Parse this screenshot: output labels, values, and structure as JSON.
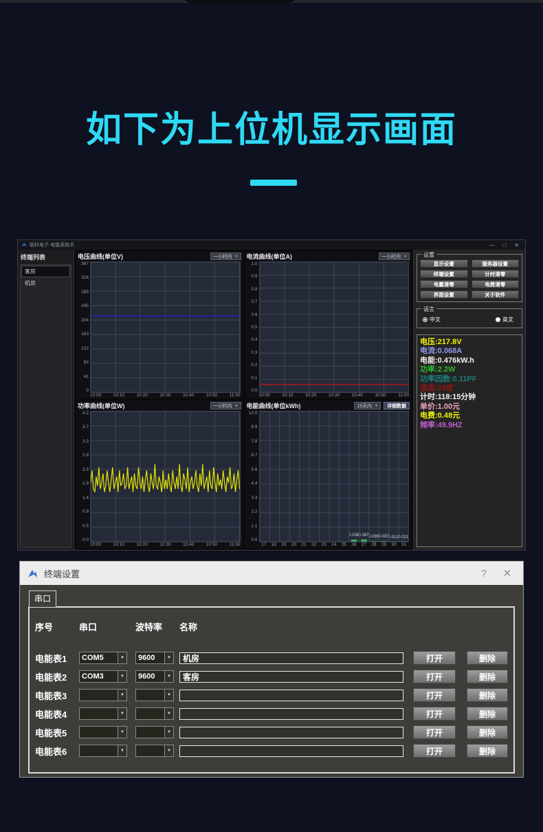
{
  "glyphs": {
    "dropdown_arrow": "▼",
    "minimize": "—",
    "maximize": "□",
    "close": "✕",
    "help": "?"
  },
  "page": {
    "heading": "如下为上位机显示画面",
    "accent_color": "#2fd9f4"
  },
  "app_window": {
    "title": "联科电子-电能表助手",
    "sidebar": {
      "title": "终端列表",
      "items": [
        {
          "label": "客房",
          "selected": true
        },
        {
          "label": "机房",
          "selected": false
        }
      ]
    },
    "right_panel": {
      "settings_group": {
        "title": "设置",
        "buttons": [
          "显示设置",
          "服务器设置",
          "终端设置",
          "计时清零",
          "电量清零",
          "电费清零",
          "界面设置",
          "关于软件"
        ]
      },
      "language_group": {
        "title": "语言",
        "options": [
          {
            "label": "中文",
            "selected": true
          },
          {
            "label": "英文",
            "selected": false
          }
        ]
      },
      "readings": [
        {
          "text": "电压:217.8V",
          "color": "#f2f20a"
        },
        {
          "text": "电流:0.068A",
          "color": "#8f9bf0"
        },
        {
          "text": "电能:0.476kW.h",
          "color": "#f2f2f2"
        },
        {
          "text": "功率:2.2W",
          "color": "#2db82d"
        },
        {
          "text": "功率因数:0.11PF",
          "color": "#1f7d7a"
        },
        {
          "text": "温度:26度",
          "color": "#8a1717"
        },
        {
          "text": "计时:118:15分钟",
          "color": "#f2f2f2"
        },
        {
          "text": "单价:1.00元",
          "color": "#eda4be"
        },
        {
          "text": "电费:0.48元",
          "color": "#f2f20a"
        },
        {
          "text": "频率:49.9HZ",
          "color": "#bb5fd0"
        }
      ]
    }
  },
  "chart_data": [
    {
      "type": "line",
      "title": "电压曲线(单位V)",
      "range_label": "一小时内",
      "color": "#1b1be0",
      "ylim": [
        0,
        367
      ],
      "y_ticks": [
        "367",
        "326",
        "285",
        "245",
        "204",
        "163",
        "122",
        "82",
        "41",
        "0"
      ],
      "x_ticks": [
        "10:00",
        "10:10",
        "10:20",
        "10:30",
        "10:40",
        "10:50",
        "11:00"
      ],
      "grid": true,
      "values": [
        215,
        216,
        215,
        214,
        215,
        216,
        215,
        214,
        213,
        214,
        215,
        216,
        215,
        215,
        214,
        215,
        216,
        215,
        214,
        215,
        216,
        217,
        215,
        214,
        215,
        214,
        213,
        214,
        215,
        216,
        215,
        214,
        215,
        216,
        215,
        214,
        215,
        216,
        215,
        215,
        214,
        213,
        214,
        215,
        216,
        215,
        214,
        215,
        216,
        215,
        214,
        215,
        216,
        215,
        216,
        215,
        214,
        215,
        216,
        217
      ]
    },
    {
      "type": "line",
      "title": "电流曲线(单位A)",
      "range_label": "一小时内",
      "color": "#c81616",
      "ylim": [
        0,
        1.0
      ],
      "y_ticks": [
        "1.0",
        "0.9",
        "0.8",
        "0.7",
        "0.6",
        "0.5",
        "0.4",
        "0.3",
        "0.2",
        "0.1",
        "0.0"
      ],
      "x_ticks": [
        "10:00",
        "10:10",
        "10:20",
        "10:30",
        "10:40",
        "10:50",
        "11:00"
      ],
      "grid": true,
      "values": [
        0.06,
        0.062,
        0.059,
        0.06,
        0.061,
        0.06,
        0.058,
        0.06,
        0.062,
        0.06,
        0.059,
        0.06,
        0.061,
        0.06,
        0.059,
        0.061,
        0.06,
        0.062,
        0.06,
        0.059,
        0.06,
        0.061,
        0.059,
        0.06,
        0.062,
        0.06,
        0.059,
        0.06,
        0.061,
        0.06,
        0.058,
        0.06,
        0.061,
        0.06,
        0.059,
        0.06,
        0.062,
        0.06,
        0.059,
        0.061,
        0.06,
        0.059,
        0.06,
        0.061,
        0.06,
        0.062,
        0.059,
        0.06,
        0.061,
        0.06,
        0.059,
        0.06,
        0.062,
        0.06,
        0.059,
        0.06,
        0.061,
        0.06,
        0.059,
        0.06
      ]
    },
    {
      "type": "line",
      "title": "功率曲线(单位W)",
      "range_label": "一小时内",
      "color": "#e6e600",
      "ylim": [
        0,
        4.2
      ],
      "y_ticks": [
        "4.2",
        "3.7",
        "3.3",
        "2.8",
        "2.3",
        "1.9",
        "1.4",
        "0.9",
        "0.5",
        "0.0"
      ],
      "x_ticks": [
        "10:00",
        "10:10",
        "10:20",
        "10:30",
        "10:40",
        "10:50",
        "11:00"
      ],
      "grid": true,
      "values": [
        1.9,
        2.3,
        1.7,
        1.6,
        2.1,
        1.8,
        2.4,
        1.7,
        1.9,
        2.2,
        1.6,
        1.8,
        2.3,
        1.9,
        1.6,
        2.0,
        2.4,
        1.7,
        1.9,
        2.1,
        1.6,
        2.3,
        1.8,
        1.9,
        2.2,
        1.7,
        1.8,
        2.4,
        1.7,
        1.9,
        2.1,
        1.6,
        2.2,
        1.8,
        1.7,
        2.4,
        1.9,
        1.7,
        2.1,
        1.6,
        2.0,
        2.3,
        1.8,
        1.6,
        2.2,
        1.9,
        1.7,
        2.5,
        1.8,
        1.7,
        2.1,
        1.9,
        1.6,
        2.3,
        1.7,
        2.0,
        1.7,
        2.2,
        1.8,
        1.6,
        2.3,
        1.9,
        1.7,
        2.1,
        1.7,
        2.5,
        1.8,
        1.6,
        2.2,
        2.0,
        1.7,
        2.4,
        1.6,
        1.9,
        2.1,
        1.7,
        1.9,
        2.3,
        1.8,
        1.6,
        2.2,
        1.8,
        2.5,
        1.7,
        1.9,
        2.1,
        1.6,
        2.3,
        1.8,
        1.7,
        2.4,
        1.9,
        1.6,
        2.2,
        1.8,
        2.0,
        1.7,
        2.3,
        1.9,
        1.6,
        2.1,
        1.9,
        2.4,
        1.7,
        1.8,
        2.2,
        1.6,
        2.0,
        2.3,
        1.7
      ]
    },
    {
      "type": "bar",
      "title": "电能曲线(单位kWh)",
      "range_label": "15天内",
      "detail_button": "详细数据",
      "color": "#3fae5a",
      "ylim": [
        0,
        10
      ],
      "y_ticks": [
        "10.0",
        "8.9",
        "7.8",
        "6.7",
        "5.6",
        "4.4",
        "3.3",
        "2.2",
        "1.1",
        "0.0"
      ],
      "categories": [
        "17",
        "18",
        "19",
        "20",
        "21",
        "22",
        "23",
        "24",
        "25",
        "26",
        "27",
        "28",
        "29",
        "30",
        "31"
      ],
      "grid": true,
      "values": [
        0,
        0,
        0,
        0,
        0,
        0,
        0,
        0,
        0,
        0.158,
        0.167,
        0.036,
        0.037,
        0.012,
        0.021
      ],
      "bar_labels": [
        "",
        "",
        "",
        "",
        "",
        "",
        "",
        "",
        "",
        "0.158",
        "0.167",
        "0.036",
        "0.037",
        "0.012",
        "0.021"
      ]
    }
  ],
  "dialog": {
    "title": "终端设置",
    "tab": "串口",
    "columns": {
      "seq": "序号",
      "port": "串口",
      "baud": "波特率",
      "name": "名称"
    },
    "rows": [
      {
        "label": "电能表1",
        "port": "COM5",
        "baud": "9600",
        "name": "机房",
        "open": "打开",
        "delete": "删除"
      },
      {
        "label": "电能表2",
        "port": "COM3",
        "baud": "9600",
        "name": "客房",
        "open": "打开",
        "delete": "删除"
      },
      {
        "label": "电能表3",
        "port": "",
        "baud": "",
        "name": "",
        "open": "打开",
        "delete": "删除"
      },
      {
        "label": "电能表4",
        "port": "",
        "baud": "",
        "name": "",
        "open": "打开",
        "delete": "删除"
      },
      {
        "label": "电能表5",
        "port": "",
        "baud": "",
        "name": "",
        "open": "打开",
        "delete": "删除"
      },
      {
        "label": "电能表6",
        "port": "",
        "baud": "",
        "name": "",
        "open": "打开",
        "delete": "删除"
      }
    ]
  }
}
